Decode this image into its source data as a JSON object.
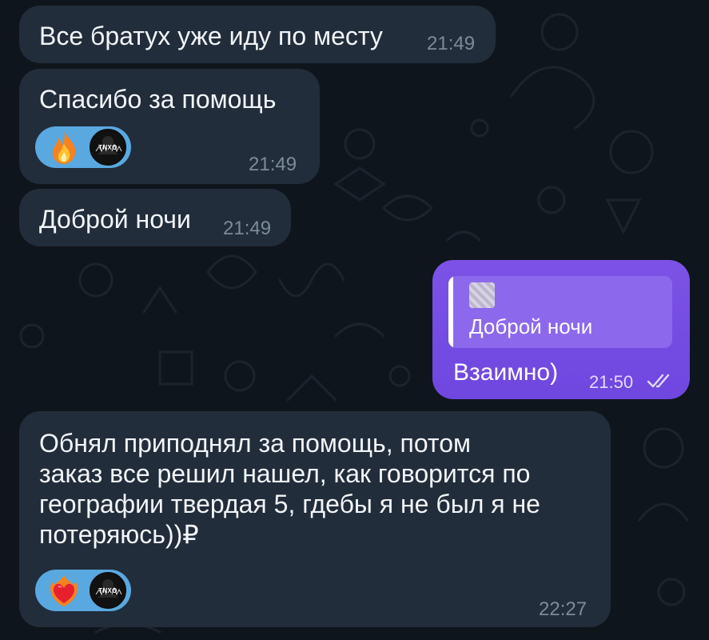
{
  "messages": [
    {
      "text": "Все братух уже иду по месту",
      "time": "21:49"
    },
    {
      "text": "Спасибо за помощь",
      "time": "21:49",
      "reactions": [
        "fire-emoji",
        "tnxo-avatar"
      ],
      "avatar_label": "TNXO"
    },
    {
      "text": "Доброй ночи",
      "time": "21:49"
    }
  ],
  "outgoing": {
    "quote_text": "Доброй ночи",
    "text": "Взаимно)",
    "time": "21:50",
    "status": "read",
    "accent": "#6f47e0"
  },
  "long_message": {
    "lines": [
      "Обнял приподнял за помощь, потом",
      "заказ все решил нашел, как говорится по",
      "географии твердая 5, гдебы я не был я не",
      "потеряюсь))₽"
    ],
    "time": "22:27",
    "reactions": [
      "heart-on-fire-emoji",
      "tnxo-avatar"
    ],
    "avatar_label": "TNXO"
  },
  "colors": {
    "incoming_bubble": "#212d3b",
    "background": "#0f151c",
    "reaction_pill": "#5aa8e0"
  }
}
